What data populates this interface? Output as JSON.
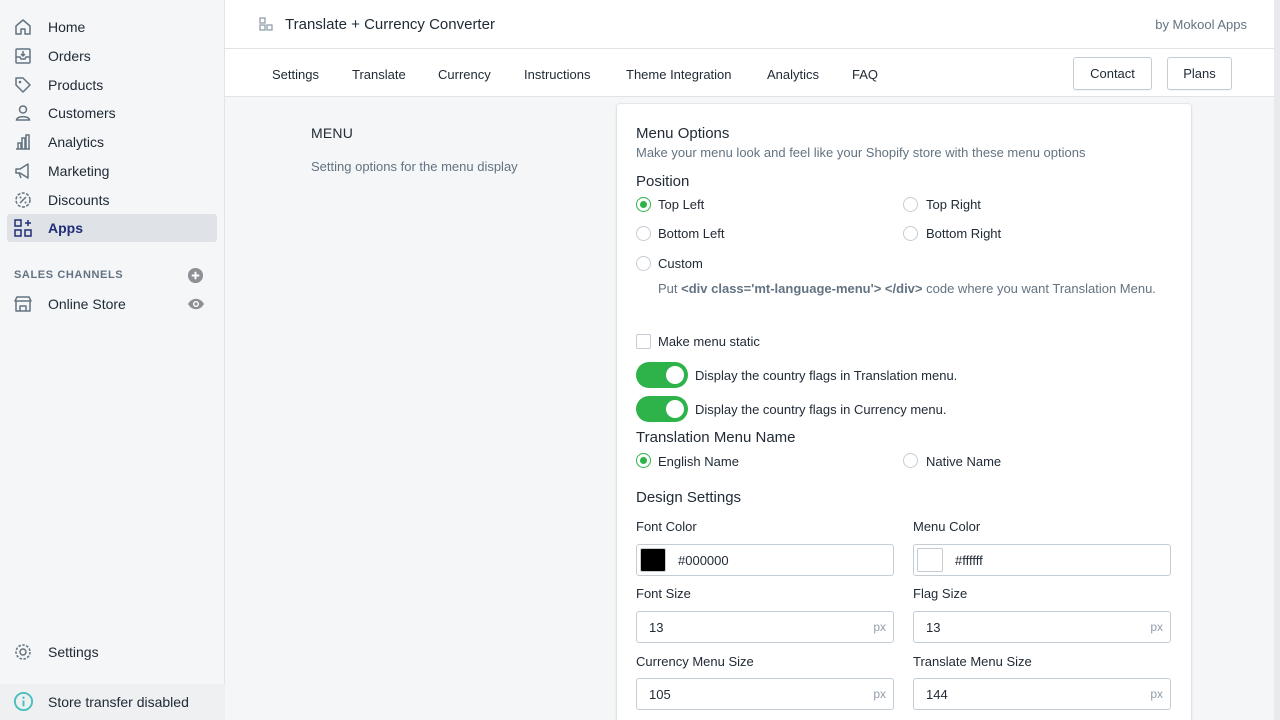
{
  "sidebar": {
    "items": [
      {
        "label": "Home",
        "icon": "home-icon"
      },
      {
        "label": "Orders",
        "icon": "orders-icon"
      },
      {
        "label": "Products",
        "icon": "tag-icon"
      },
      {
        "label": "Customers",
        "icon": "person-icon"
      },
      {
        "label": "Analytics",
        "icon": "bar-chart-icon"
      },
      {
        "label": "Marketing",
        "icon": "megaphone-icon"
      },
      {
        "label": "Discounts",
        "icon": "discount-icon"
      },
      {
        "label": "Apps",
        "icon": "apps-icon",
        "active": true
      }
    ],
    "sales_channels_title": "SALES CHANNELS",
    "online_store": "Online Store",
    "settings": "Settings",
    "store_transfer": "Store transfer disabled"
  },
  "header": {
    "app_title": "Translate + Currency Converter",
    "by": "by Mokool Apps"
  },
  "tabs": [
    "Settings",
    "Translate",
    "Currency",
    "Instructions",
    "Theme Integration",
    "Analytics",
    "FAQ"
  ],
  "buttons": {
    "contact": "Contact",
    "plans": "Plans"
  },
  "section": {
    "title": "MENU",
    "description": "Setting options for the menu display"
  },
  "card": {
    "title": "Menu Options",
    "subtitle": "Make your menu look and feel like your Shopify store with these menu options",
    "position_title": "Position",
    "positions": {
      "top_left": "Top Left",
      "top_right": "Top Right",
      "bottom_left": "Bottom Left",
      "bottom_right": "Bottom Right",
      "custom": "Custom",
      "selected": "Top Left"
    },
    "custom_note_prefix": "Put",
    "custom_note_code": "<div class='mt-language-menu'> </div>",
    "custom_note_suffix": "code where you want Translation Menu.",
    "static_label": "Make menu static",
    "flags_translation": "Display the country flags in Translation menu.",
    "flags_currency": "Display the country flags in Currency menu.",
    "menu_name_title": "Translation Menu Name",
    "english_name": "English Name",
    "native_name": "Native Name",
    "design_title": "Design Settings",
    "font_color_label": "Font Color",
    "font_color_value": "#000000",
    "menu_color_label": "Menu Color",
    "menu_color_value": "#ffffff",
    "font_size_label": "Font Size",
    "font_size_value": "13",
    "flag_size_label": "Flag Size",
    "flag_size_value": "13",
    "currency_menu_size_label": "Currency Menu Size",
    "currency_menu_size_value": "105",
    "translate_menu_size_label": "Translate Menu Size",
    "translate_menu_size_value": "144",
    "unit": "px"
  },
  "colors": {
    "accent": "#2db34a",
    "active_nav": "#202e78"
  }
}
